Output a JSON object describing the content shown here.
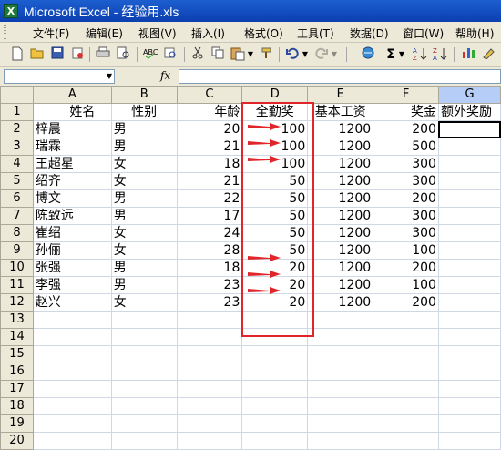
{
  "window": {
    "title": "Microsoft Excel - 经验用.xls"
  },
  "menu": [
    "文件(F)",
    "编辑(E)",
    "视图(V)",
    "插入(I)",
    "格式(O)",
    "工具(T)",
    "数据(D)",
    "窗口(W)",
    "帮助(H)"
  ],
  "toolbar": {
    "icons": [
      "new-icon",
      "open-icon",
      "save-icon",
      "permission-icon",
      "print-icon",
      "print-preview-icon",
      "spelling-icon",
      "research-icon",
      "cut-icon",
      "copy-icon",
      "paste-icon",
      "format-painter-icon",
      "undo-icon",
      "redo-icon",
      "hyperlink-icon",
      "autosum-icon",
      "sort-ascending-icon",
      "sort-descending-icon",
      "chart-wizard-icon",
      "drawing-icon"
    ],
    "autosum": "Σ"
  },
  "formula_bar": {
    "name_box": "",
    "fx": "fx",
    "value": ""
  },
  "columns": [
    "A",
    "B",
    "C",
    "D",
    "E",
    "F",
    "G"
  ],
  "selected_column": "G",
  "rows": [
    {
      "n": "1",
      "cells": [
        "姓名",
        "性别",
        "年龄",
        "全勤奖",
        "基本工资",
        "奖金",
        "额外奖励"
      ]
    },
    {
      "n": "2",
      "cells": [
        "梓晨",
        "男",
        "20",
        "100",
        "1200",
        "200",
        ""
      ]
    },
    {
      "n": "3",
      "cells": [
        "瑞霖",
        "男",
        "21",
        "100",
        "1200",
        "500",
        ""
      ]
    },
    {
      "n": "4",
      "cells": [
        "王超星",
        "女",
        "18",
        "100",
        "1200",
        "300",
        ""
      ]
    },
    {
      "n": "5",
      "cells": [
        "绍齐",
        "女",
        "21",
        "50",
        "1200",
        "300",
        ""
      ]
    },
    {
      "n": "6",
      "cells": [
        "博文",
        "男",
        "22",
        "50",
        "1200",
        "200",
        ""
      ]
    },
    {
      "n": "7",
      "cells": [
        "陈致远",
        "男",
        "17",
        "50",
        "1200",
        "300",
        ""
      ]
    },
    {
      "n": "8",
      "cells": [
        "崔绍",
        "女",
        "24",
        "50",
        "1200",
        "300",
        ""
      ]
    },
    {
      "n": "9",
      "cells": [
        "孙俪",
        "女",
        "28",
        "50",
        "1200",
        "100",
        ""
      ]
    },
    {
      "n": "10",
      "cells": [
        "张强",
        "男",
        "18",
        "20",
        "1200",
        "200",
        ""
      ]
    },
    {
      "n": "11",
      "cells": [
        "李强",
        "男",
        "23",
        "20",
        "1200",
        "100",
        ""
      ]
    },
    {
      "n": "12",
      "cells": [
        "赵兴",
        "女",
        "23",
        "20",
        "1200",
        "200",
        ""
      ]
    },
    {
      "n": "13",
      "cells": [
        "",
        "",
        "",
        "",
        "",
        "",
        ""
      ]
    },
    {
      "n": "14",
      "cells": [
        "",
        "",
        "",
        "",
        "",
        "",
        ""
      ]
    },
    {
      "n": "15",
      "cells": [
        "",
        "",
        "",
        "",
        "",
        "",
        ""
      ]
    },
    {
      "n": "16",
      "cells": [
        "",
        "",
        "",
        "",
        "",
        "",
        ""
      ]
    },
    {
      "n": "17",
      "cells": [
        "",
        "",
        "",
        "",
        "",
        "",
        ""
      ]
    },
    {
      "n": "18",
      "cells": [
        "",
        "",
        "",
        "",
        "",
        "",
        ""
      ]
    },
    {
      "n": "19",
      "cells": [
        "",
        "",
        "",
        "",
        "",
        "",
        ""
      ]
    },
    {
      "n": "20",
      "cells": [
        "",
        "",
        "",
        "",
        "",
        "",
        ""
      ]
    }
  ],
  "annotation_color": "#e0262a",
  "arrow_rows": [
    "2",
    "3",
    "4",
    "10",
    "11",
    "12"
  ]
}
